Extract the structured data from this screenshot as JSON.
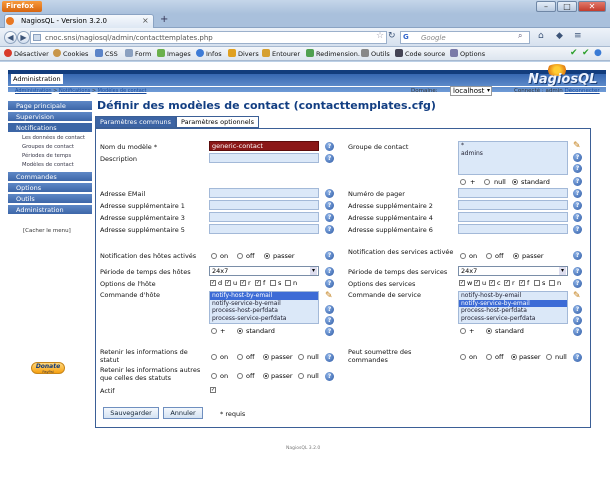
{
  "browser": {
    "app_button": "Firefox",
    "tab_title": "NagiosQL - Version 3.2.0",
    "new_tab": "+",
    "url": "cnoc.snsi/nagiosql/admin/contacttemplates.php",
    "search_engine": "Google",
    "search_placeholder": "Google"
  },
  "devbar": {
    "items": [
      "Désactiver",
      "Cookies",
      "CSS",
      "Form",
      "Images",
      "Infos",
      "Divers",
      "Entourer",
      "Redimension.",
      "Outils",
      "Code source",
      "Options"
    ]
  },
  "app": {
    "admin_tab": "Administration",
    "logo": "NagiosQL",
    "breadcrumb": [
      "Administration",
      "Notifications",
      "Modèles de contact"
    ],
    "domain_label": "Domaine:",
    "domain_value": "localhost",
    "user_prefix": "Connecté : admin",
    "logout": "Déconnecter",
    "hide_menu": "[Cacher le menu]",
    "donate": "Donate",
    "donate_small": "PayPal",
    "footer": "NagiosQL 3.2.0"
  },
  "sidebar": {
    "items": [
      "Page principale",
      "Supervision",
      "Notifications",
      "Commandes",
      "Options",
      "Outils",
      "Administration"
    ],
    "subitems": [
      "Les données de contact",
      "Groupes de contact",
      "Périodes de temps",
      "Modèles de contact"
    ]
  },
  "form": {
    "title": "Définir des modèles de contact (contacttemplates.cfg)",
    "tab_common": "Paramètres communs",
    "tab_optional": "Paramètres optionnels",
    "model_name_label": "Nom du modèle *",
    "model_name_value": "generic-contact",
    "description_label": "Description",
    "contact_group_label": "Groupe de contact",
    "contact_group_items": [
      "*",
      "admins"
    ],
    "plus": "+",
    "null": "null",
    "standard": "standard",
    "email_label": "Adresse EMail",
    "pager_label": "Numéro de pager",
    "addr1": "Adresse supplémentaire 1",
    "addr2": "Adresse supplémentaire 2",
    "addr3": "Adresse supplémentaire 3",
    "addr4": "Adresse supplémentaire 4",
    "addr5": "Adresse supplémentaire 5",
    "addr6": "Adresse supplémentaire 6",
    "host_notif_label": "Notification des hôtes activés",
    "service_notif_label": "Notification des services activée",
    "on": "on",
    "off": "off",
    "passer": "passer",
    "host_period_label": "Période de temps des hôtes",
    "host_period_value": "24x7",
    "service_period_label": "Période de temps des services",
    "service_period_value": "24x7",
    "host_options_label": "Options de l'hôte",
    "host_options": [
      "d",
      "u",
      "r",
      "f",
      "s",
      "n"
    ],
    "host_options_checked": [
      true,
      true,
      true,
      true,
      false,
      false
    ],
    "service_options_label": "Options des services",
    "service_options": [
      "w",
      "u",
      "c",
      "r",
      "f",
      "s",
      "n"
    ],
    "service_options_checked": [
      true,
      true,
      true,
      true,
      true,
      false,
      false
    ],
    "host_command_label": "Commande d'hôte",
    "host_commands": [
      "notify-host-by-email",
      "notify-service-by-email",
      "process-host-perfdata",
      "process-service-perfdata"
    ],
    "service_command_label": "Commande de service",
    "service_commands": [
      "notify-host-by-email",
      "notify-service-by-email",
      "process-host-perfdata",
      "process-service-perfdata"
    ],
    "retain_status_label_1": "Retenir les informations de",
    "retain_status_label_2": "statut",
    "can_submit_label_1": "Peut soumettre des",
    "can_submit_label_2": "commandes",
    "retain_nonstatus_label_1": "Retenir les informations autres",
    "retain_nonstatus_label_2": "que celles des statuts",
    "active_label": "Actif",
    "save": "Sauvegarder",
    "cancel": "Annuler",
    "required": "* requis"
  },
  "colors": {
    "accent": "#3c64a4",
    "required_field": "#8b1818",
    "field_bg": "#dbe8f8"
  }
}
